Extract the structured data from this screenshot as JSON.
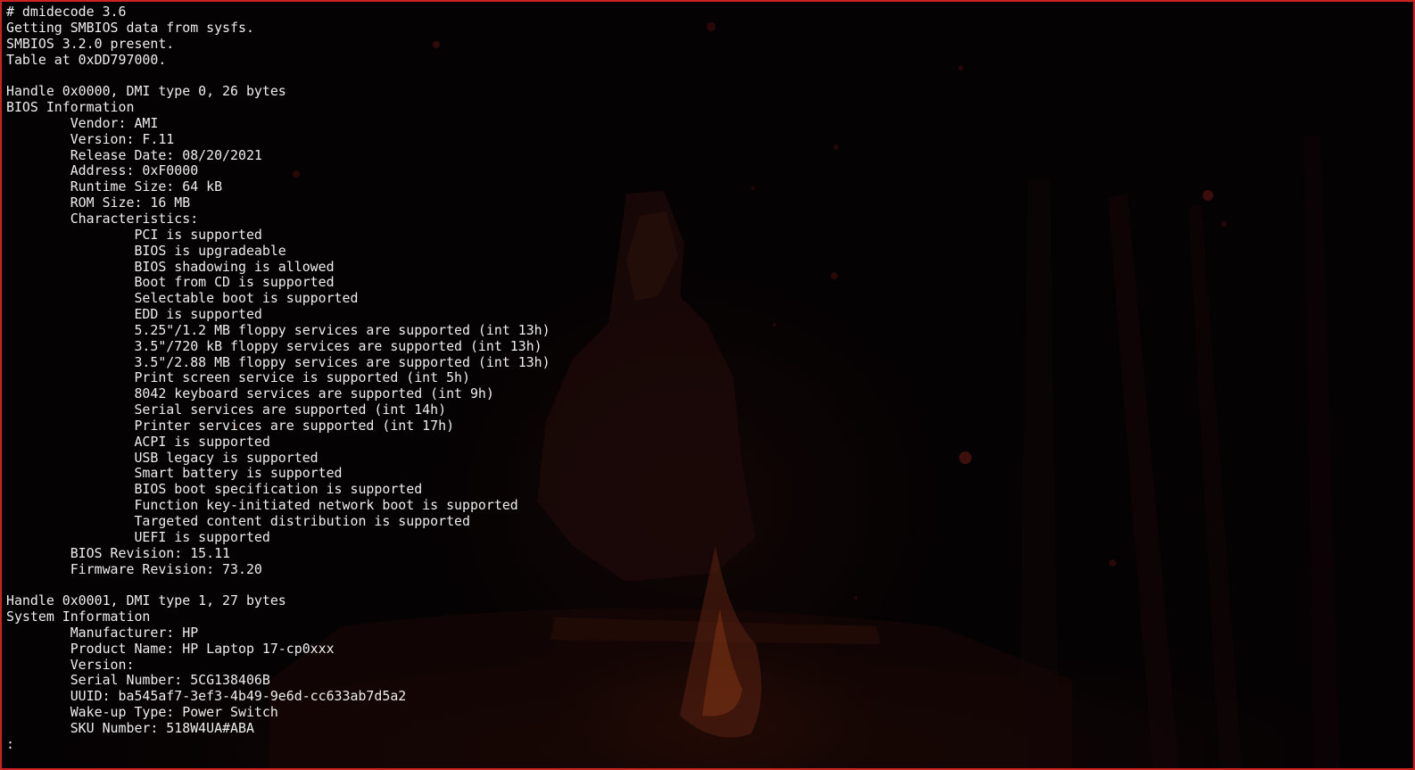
{
  "terminal": {
    "lines": [
      "# dmidecode 3.6",
      "Getting SMBIOS data from sysfs.",
      "SMBIOS 3.2.0 present.",
      "Table at 0xDD797000.",
      "",
      "Handle 0x0000, DMI type 0, 26 bytes",
      "BIOS Information",
      "\tVendor: AMI",
      "\tVersion: F.11",
      "\tRelease Date: 08/20/2021",
      "\tAddress: 0xF0000",
      "\tRuntime Size: 64 kB",
      "\tROM Size: 16 MB",
      "\tCharacteristics:",
      "\t\tPCI is supported",
      "\t\tBIOS is upgradeable",
      "\t\tBIOS shadowing is allowed",
      "\t\tBoot from CD is supported",
      "\t\tSelectable boot is supported",
      "\t\tEDD is supported",
      "\t\t5.25\"/1.2 MB floppy services are supported (int 13h)",
      "\t\t3.5\"/720 kB floppy services are supported (int 13h)",
      "\t\t3.5\"/2.88 MB floppy services are supported (int 13h)",
      "\t\tPrint screen service is supported (int 5h)",
      "\t\t8042 keyboard services are supported (int 9h)",
      "\t\tSerial services are supported (int 14h)",
      "\t\tPrinter services are supported (int 17h)",
      "\t\tACPI is supported",
      "\t\tUSB legacy is supported",
      "\t\tSmart battery is supported",
      "\t\tBIOS boot specification is supported",
      "\t\tFunction key-initiated network boot is supported",
      "\t\tTargeted content distribution is supported",
      "\t\tUEFI is supported",
      "\tBIOS Revision: 15.11",
      "\tFirmware Revision: 73.20",
      "",
      "Handle 0x0001, DMI type 1, 27 bytes",
      "System Information",
      "\tManufacturer: HP",
      "\tProduct Name: HP Laptop 17-cp0xxx",
      "\tVersion:",
      "\tSerial Number: 5CG138406B",
      "\tUUID: ba545af7-3ef3-4b49-9e6d-cc633ab7d5a2",
      "\tWake-up Type: Power Switch",
      "\tSKU Number: 518W4UA#ABA",
      ":"
    ]
  },
  "colors": {
    "border": "#cc2222",
    "text": "#eeeeee",
    "background": "#050203"
  }
}
